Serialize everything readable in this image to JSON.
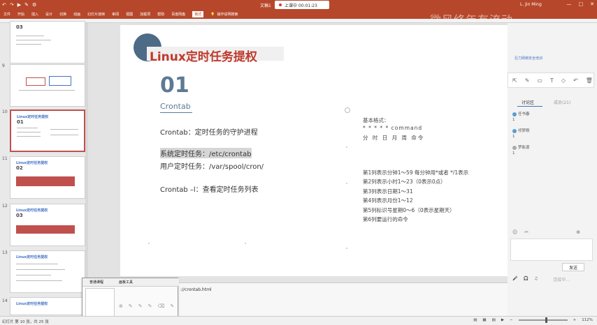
{
  "titlebar": {
    "quick_access": [
      "↶",
      "↷",
      "▶",
      "✎",
      "⚙"
    ],
    "document": "文稿1",
    "recording": "上课中 00:01:23",
    "user": "L. Jin Ming",
    "window_buttons": [
      "—",
      "□",
      "✕"
    ]
  },
  "ribbon": {
    "tabs": [
      "文件",
      "开始",
      "插入",
      "设计",
      "切换",
      "动画",
      "幻灯片放映",
      "审阅",
      "视图",
      "加载项",
      "帮助",
      "百度网盘",
      "格式"
    ],
    "active_tab": "开始",
    "tell_me": "操作说明搜索",
    "watermark": "微风终年有流动"
  },
  "thumbnails": [
    {
      "num": "",
      "title": "",
      "big": "03",
      "style": "text"
    },
    {
      "num": "9",
      "title": "",
      "big": "",
      "style": "diagram"
    },
    {
      "num": "10",
      "title": "Linux定时任务提权",
      "big": "01",
      "style": "text",
      "selected": true
    },
    {
      "num": "11",
      "title": "Linux定时任务提权",
      "big": "02",
      "style": "red"
    },
    {
      "num": "12",
      "title": "Linux定时任务提权",
      "big": "03",
      "style": "red"
    },
    {
      "num": "13",
      "title": "Linux定时任务提权",
      "big": "",
      "style": "text"
    },
    {
      "num": "14",
      "title": "Linux定时任务提权",
      "big": "",
      "style": "text"
    }
  ],
  "slide": {
    "title": "Linux定时任务提权",
    "number": "01",
    "subtitle": "Crontab",
    "lines": {
      "l1": "Crontab：定时任务的守护进程",
      "l2": "系统定时任务：/etc/crontab",
      "l3": "用户定时任务：/var/spool/cron/",
      "l4": "Crontab –l：查看定时任务列表"
    },
    "format": {
      "header": "基本格式：",
      "stars": "*    *    *    *    *    command",
      "labels": "分   时   日   月   周   命令",
      "rows": [
        "第1列表示分钟1～59  每分钟用*或者 */1表示",
        "第2列表示小时1～23（0表示0点）",
        "第3列表示日期1～31",
        "第4列表示月份1～12",
        "第5列标识号星期0～6（0表示星期天）",
        "第6列要运行的命令"
      ]
    }
  },
  "right_panel": {
    "logo": "巨力网络安全培训",
    "tools": [
      "⇱",
      "✎",
      "▭",
      "T",
      "◇",
      "↶",
      "🗑"
    ],
    "tab_discuss": "讨论区",
    "tab_members": "成员(21)",
    "messages": [
      {
        "user": "任书春",
        "text": "1"
      },
      {
        "user": "祁梦刚",
        "text": "1"
      },
      {
        "user": "罗新源",
        "text": "1"
      }
    ],
    "input_icons": [
      "☺",
      "✂",
      "⊕"
    ],
    "send": "发送",
    "bottom": [
      "🎤",
      "🎧",
      "♫",
      "连接中..."
    ]
  },
  "notes": {
    "url": "://crontab.html"
  },
  "popup": {
    "tab1": "普通课程",
    "tab2": "画板工具",
    "icons": [
      "⊕",
      "✎",
      "✎",
      "✎",
      "⌫",
      "✎"
    ]
  },
  "status": {
    "left": "幻灯片 第 10 张，共 25 张",
    "icons": [
      "▤",
      "▦",
      "▤",
      "▶"
    ],
    "zoom": "112%"
  }
}
